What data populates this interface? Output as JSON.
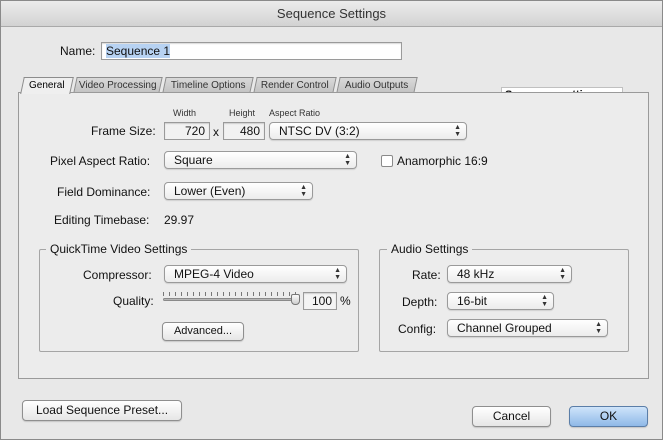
{
  "window": {
    "title": "Sequence Settings"
  },
  "name": {
    "label": "Name:",
    "value": "Sequence 1"
  },
  "tabs": [
    {
      "label": "General",
      "active": true
    },
    {
      "label": "Video Processing"
    },
    {
      "label": "Timeline Options"
    },
    {
      "label": "Render Control"
    },
    {
      "label": "Audio Outputs"
    }
  ],
  "tooltip": "Sequence settings",
  "frame_size": {
    "label": "Frame Size:",
    "width_label": "Width",
    "height_label": "Height",
    "aspect_label": "Aspect Ratio",
    "width": "720",
    "times": "x",
    "height": "480",
    "aspect": "NTSC DV (3:2)"
  },
  "pixel_aspect": {
    "label": "Pixel Aspect Ratio:",
    "value": "Square",
    "anamorphic_label": "Anamorphic 16:9",
    "anamorphic_checked": false
  },
  "field_dominance": {
    "label": "Field Dominance:",
    "value": "Lower (Even)"
  },
  "timebase": {
    "label": "Editing Timebase:",
    "value": "29.97"
  },
  "quicktime": {
    "title": "QuickTime Video Settings",
    "compressor_label": "Compressor:",
    "compressor": "MPEG-4 Video",
    "quality_label": "Quality:",
    "quality_value": "100",
    "quality_unit": "%",
    "quality_fraction": 1.0,
    "advanced_label": "Advanced..."
  },
  "audio": {
    "title": "Audio Settings",
    "rate_label": "Rate:",
    "rate": "48 kHz",
    "depth_label": "Depth:",
    "depth": "16-bit",
    "config_label": "Config:",
    "config": "Channel Grouped"
  },
  "buttons": {
    "load_preset": "Load Sequence Preset...",
    "cancel": "Cancel",
    "ok": "OK"
  }
}
